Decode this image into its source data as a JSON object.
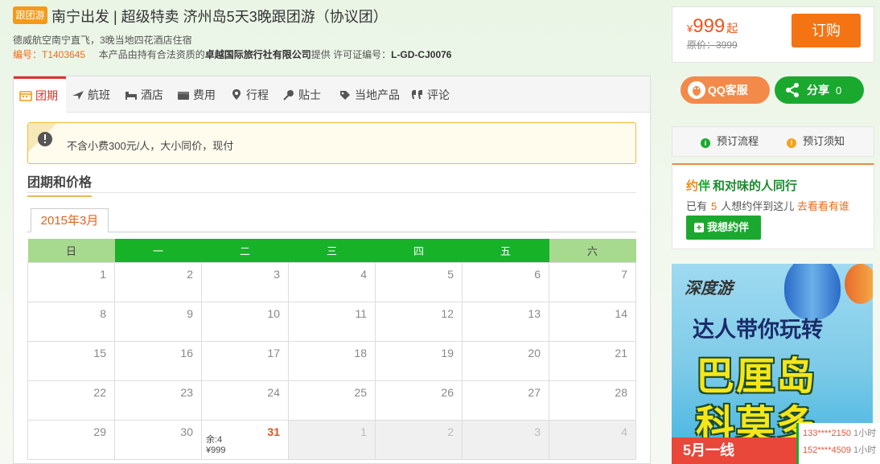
{
  "header": {
    "tag": "跟团游",
    "title": "南宁出发 | 超级特卖 济州岛5天3晚跟团游（协议团）",
    "subtitle": "德威航空南宁直飞，3晚当地四花酒店住宿",
    "code_label": "编号：T1403645",
    "provider_prefix": "本产品由持有合法资质的",
    "provider_name": "卓越国际旅行社有限公司",
    "provider_suffix": "提供 许可证编号：",
    "license": "L-GD-CJ0076"
  },
  "price": {
    "currency": "¥",
    "value": "999",
    "suffix": "起",
    "original": "原价：3999",
    "buy_label": "订购"
  },
  "share": {
    "qq_label": "QQ客服",
    "share_label": "分享",
    "share_count": "0"
  },
  "tabs": [
    {
      "label": "团期",
      "icon": "calendar-icon"
    },
    {
      "label": "航班",
      "icon": "plane-icon"
    },
    {
      "label": "酒店",
      "icon": "bed-icon"
    },
    {
      "label": "费用",
      "icon": "wallet-icon"
    },
    {
      "label": "行程",
      "icon": "location-pin-icon"
    },
    {
      "label": "贴士",
      "icon": "pushpin-icon"
    },
    {
      "label": "当地产品",
      "icon": "tag-icon"
    },
    {
      "label": "评论",
      "icon": "quote-icon"
    }
  ],
  "notice": "不含小费300元/人，大小同价，现付",
  "section_title": "团期和价格",
  "month_tab": "2015年3月",
  "calendar": {
    "weekdays": [
      "日",
      "一",
      "二",
      "三",
      "四",
      "五",
      "六"
    ],
    "weeks": [
      [
        "1",
        "2",
        "3",
        "4",
        "5",
        "6",
        "7"
      ],
      [
        "8",
        "9",
        "10",
        "11",
        "12",
        "13",
        "14"
      ],
      [
        "15",
        "16",
        "17",
        "18",
        "19",
        "20",
        "21"
      ],
      [
        "22",
        "23",
        "24",
        "25",
        "26",
        "27",
        "28"
      ],
      [
        "29",
        "30",
        "31",
        "1",
        "2",
        "3",
        "4"
      ]
    ],
    "departure": {
      "day": "31",
      "remaining": "余:4",
      "price": "¥999"
    }
  },
  "booking": {
    "flow_label": "预订流程",
    "notes_label": "预订须知"
  },
  "companion": {
    "logo_a": "约",
    "logo_b": "伴",
    "title": "和对味的人同行",
    "count_prefix": "已有",
    "count": "5",
    "count_suffix": "人想约伴到这儿",
    "link": "去看看有谁",
    "button": "我想约伴"
  },
  "banner": {
    "brand": "深度游",
    "line1": "达人带你玩转",
    "line2": "巴厘岛",
    "line3": "科莫多",
    "bottom": "5月一线"
  },
  "ticker": [
    {
      "phone": "133****2150",
      "time": "1小时"
    },
    {
      "phone": "152****4509",
      "time": "1小时"
    }
  ]
}
